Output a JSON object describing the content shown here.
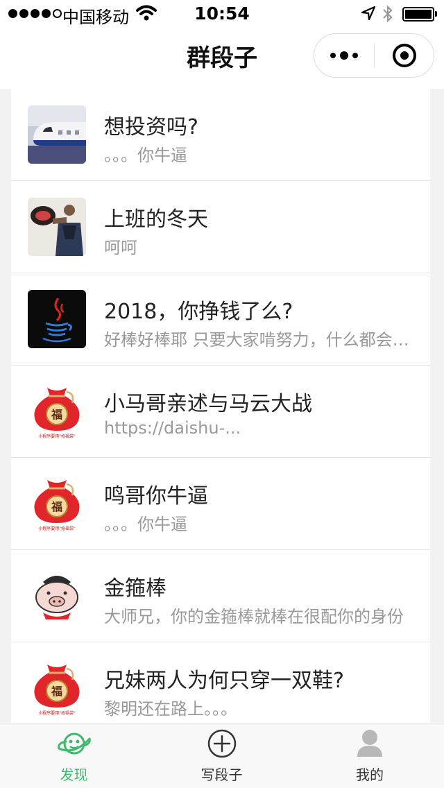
{
  "status_bar": {
    "carrier": "中国移动",
    "time": "10:54",
    "signal_icon": "signal-dots-icon",
    "wifi_icon": "wifi-icon",
    "location_icon": "location-arrow-icon",
    "bluetooth_icon": "bluetooth-icon",
    "battery_level": 1.0
  },
  "nav": {
    "title": "群段子",
    "more_icon": "more-dots-icon",
    "close_icon": "target-close-icon"
  },
  "list": {
    "items": [
      {
        "title": "想投资吗?",
        "subtitle": "。。。你牛逼",
        "thumb": "airplane-image"
      },
      {
        "title": "上班的冬天",
        "subtitle": "呵呵",
        "thumb": "man-photo-image"
      },
      {
        "title": "2018，你挣钱了么?",
        "subtitle": "好棒好棒耶 只要大家啃努力，什么都会有的",
        "thumb": "java-cup-logo"
      },
      {
        "title": "小马哥亲述与马云大战",
        "subtitle": "https://daishu-...",
        "thumb": "fortune-bag-image"
      },
      {
        "title": "鸣哥你牛逼",
        "subtitle": "。。。你牛逼",
        "thumb": "fortune-bag-image"
      },
      {
        "title": "金箍棒",
        "subtitle": "大师兄，你的金箍棒就棒在很配你的身份",
        "thumb": "pig-cartoon-image"
      },
      {
        "title": "兄妹两人为何只穿一双鞋?",
        "subtitle": "黎明还在路上。。。",
        "thumb": "fortune-bag-image"
      }
    ],
    "bag_char": "福",
    "bag_caption": "小程序要用\"抢福袋\""
  },
  "tabs": [
    {
      "label": "发现",
      "icon": "planet-icon",
      "active": true
    },
    {
      "label": "写段子",
      "icon": "plus-circle-icon",
      "active": false
    },
    {
      "label": "我的",
      "icon": "user-icon",
      "active": false
    }
  ],
  "colors": {
    "accent": "#3cbb6b",
    "background": "#f2f2f2",
    "subtitle": "#999999",
    "bag_red": "#e0262a"
  }
}
